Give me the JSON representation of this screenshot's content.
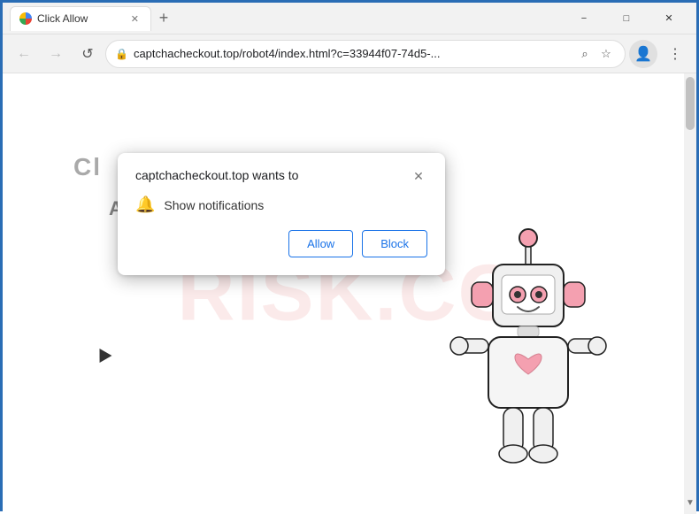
{
  "browser": {
    "tab": {
      "title": "Click Allow",
      "favicon_alt": "website-favicon"
    },
    "window_controls": {
      "minimize": "−",
      "maximize": "□",
      "close": "✕"
    },
    "new_tab": "+",
    "nav": {
      "back_label": "←",
      "forward_label": "→",
      "refresh_label": "↺",
      "url": "captchacheckout.top/robot4/index.html?c=33944f07-74d5-...",
      "search_icon": "⌕",
      "bookmark_icon": "☆",
      "profile_icon": "👤",
      "menu_icon": "⋮"
    }
  },
  "page": {
    "watermark": "RISK.CO",
    "captcha_label": "Cl",
    "are_not_robot": "ARE NOT A ROBOT.",
    "scrollbar_top": "▲",
    "scrollbar_bottom": "▼"
  },
  "permission_popup": {
    "title": "captchacheckout.top wants to",
    "close_icon": "✕",
    "notification_row": {
      "bell_icon": "🔔",
      "label": "Show notifications"
    },
    "buttons": {
      "allow": "Allow",
      "block": "Block"
    }
  }
}
